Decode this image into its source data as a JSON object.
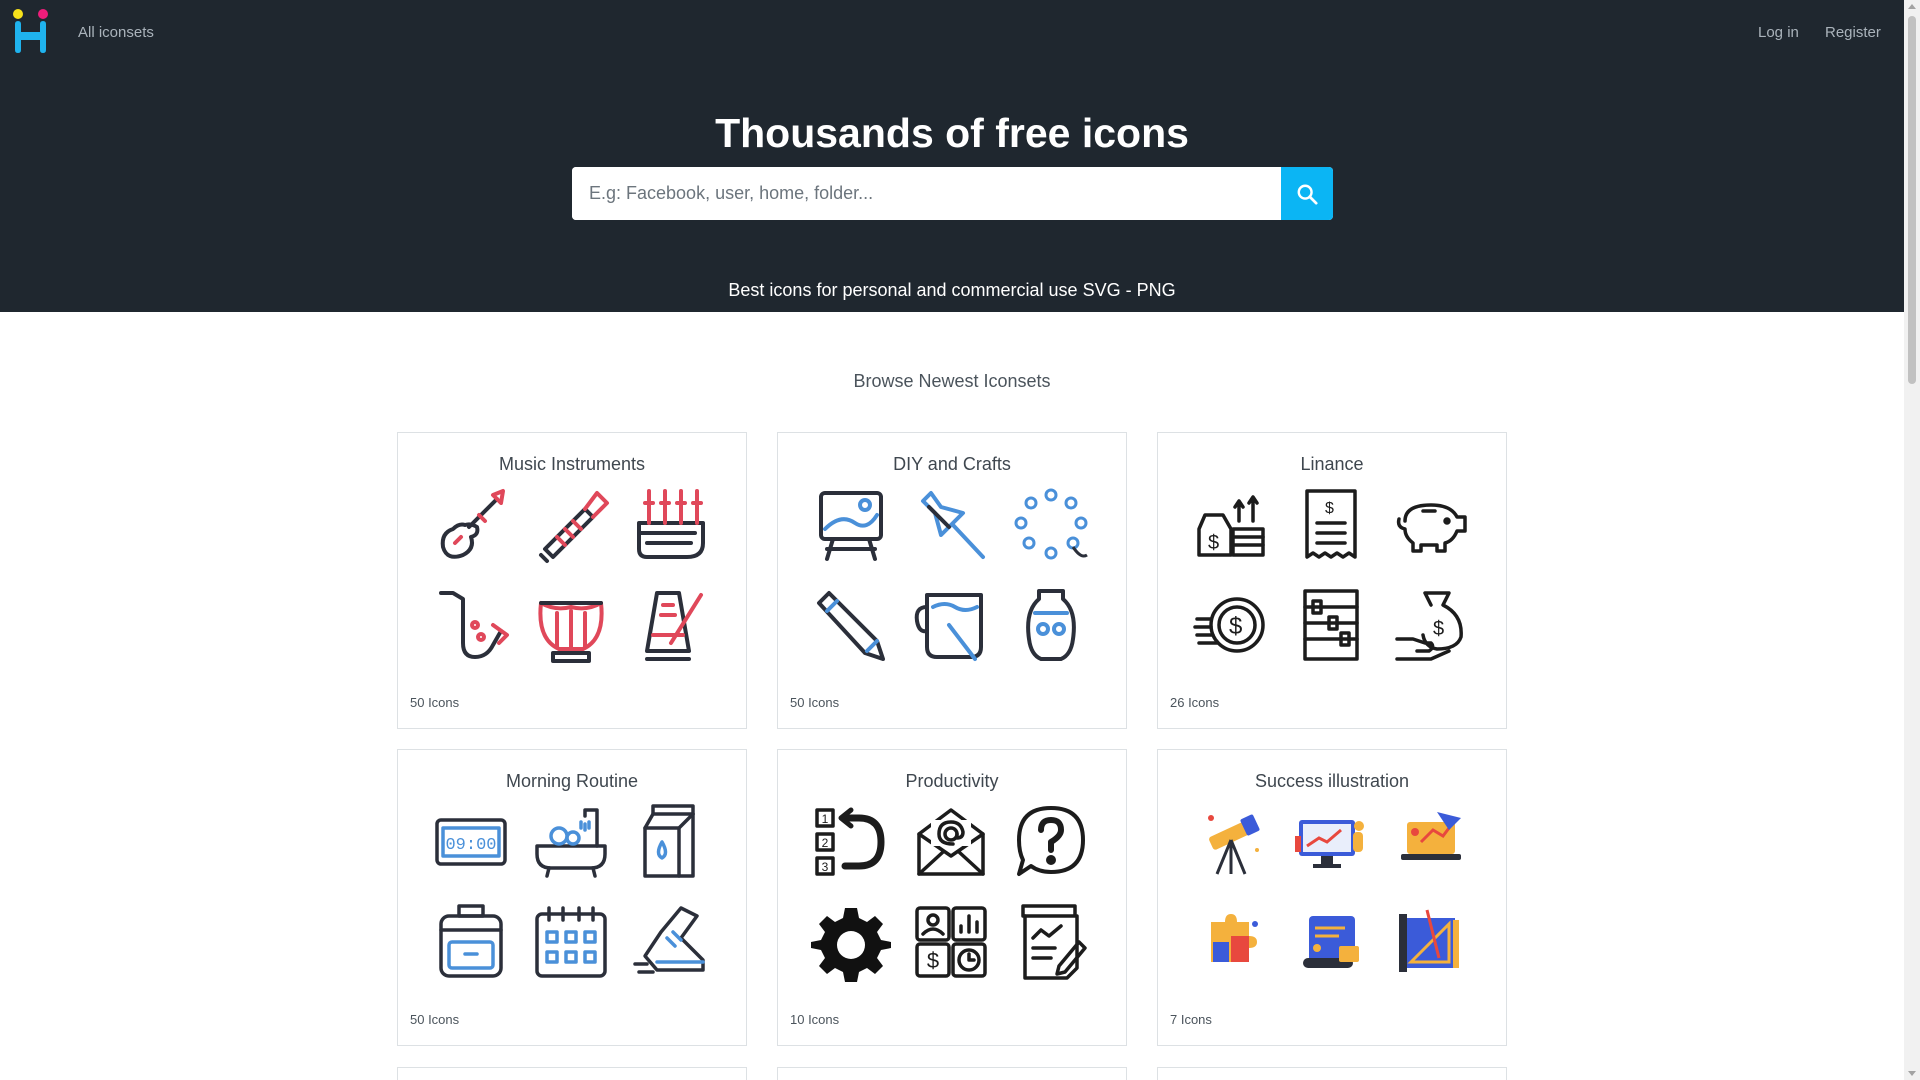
{
  "nav": {
    "all_iconsets": "All iconsets",
    "login": "Log in",
    "register": "Register"
  },
  "hero": {
    "title": "Thousands of free icons",
    "search_placeholder": "E.g: Facebook, user, home, folder...",
    "subtitle": "Best icons for personal and commercial use SVG - PNG"
  },
  "colors": {
    "hero_bg": "#1f272f",
    "accent": "#0bb5f4",
    "logo_yellow": "#f7e21b",
    "logo_pink": "#ee1d7b",
    "logo_blue": "#1fb3ee"
  },
  "section": {
    "title": "Browse Newest Iconsets"
  },
  "iconsets": [
    {
      "title": "Music Instruments",
      "count": "50 Icons",
      "icons": [
        "guitar-icon",
        "flute-icon",
        "bagpipe-icon",
        "saxophone-icon",
        "harp-icon",
        "metronome-icon"
      ]
    },
    {
      "title": "DIY and Crafts",
      "count": "50 Icons",
      "icons": [
        "easel-icon",
        "pushpin-icon",
        "beads-icon",
        "pencil-icon",
        "paint-cup-icon",
        "vase-icon"
      ]
    },
    {
      "title": "Linance",
      "count": "26 Icons",
      "icons": [
        "money-growth-icon",
        "receipt-icon",
        "piggy-bank-icon",
        "coins-icon",
        "abacus-icon",
        "money-bag-hand-icon"
      ]
    },
    {
      "title": "Morning Routine",
      "count": "50 Icons",
      "icons": [
        "digital-clock-icon",
        "bathtub-icon",
        "milk-carton-icon",
        "backpack-icon",
        "calendar-icon",
        "sneaker-icon"
      ]
    },
    {
      "title": "Productivity",
      "count": "10 Icons",
      "icons": [
        "ordered-list-icon",
        "email-icon",
        "question-icon",
        "gear-icon",
        "dashboard-icon",
        "notepad-icon"
      ]
    },
    {
      "title": "Success illustration",
      "count": "7 Icons",
      "icons": [
        "telescope-icon",
        "presentation-icon",
        "laptop-icon",
        "puzzle-icon",
        "scroll-icon",
        "blueprint-icon"
      ]
    }
  ],
  "clock_text": "09:00"
}
